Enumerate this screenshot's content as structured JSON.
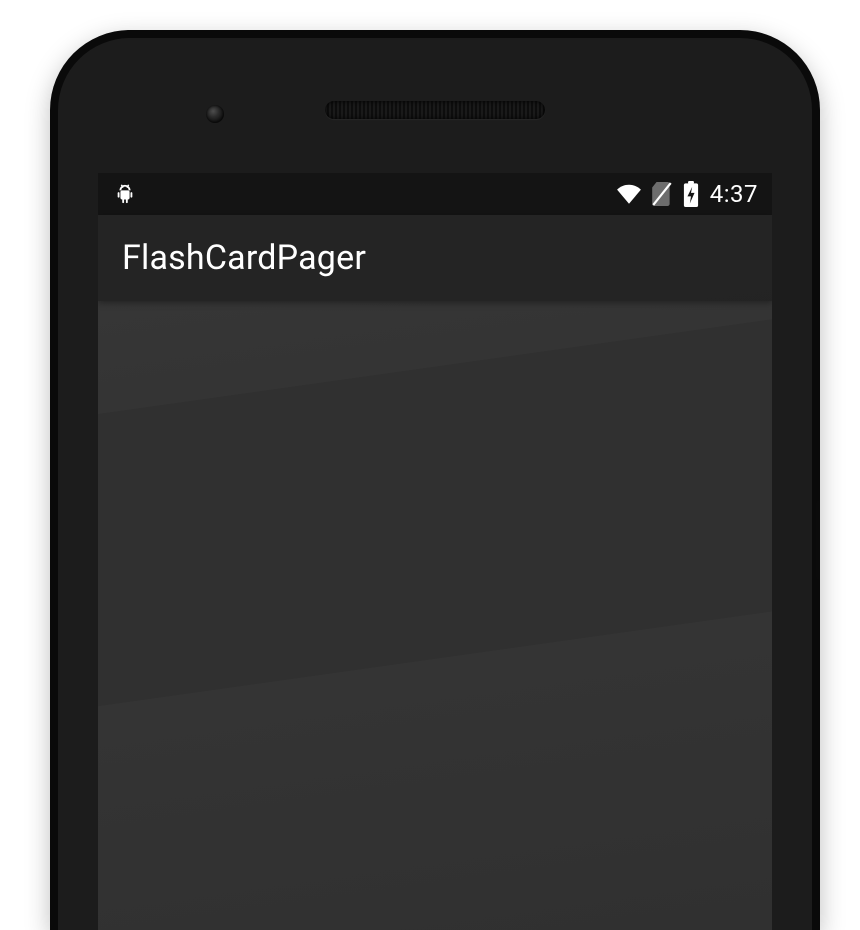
{
  "statusbar": {
    "debug_icon": "android-debug-icon",
    "wifi_icon": "wifi-icon",
    "sim_icon": "no-sim-icon",
    "battery_icon": "battery-charging-icon",
    "clock": "4:37"
  },
  "appbar": {
    "title": "FlashCardPager"
  }
}
